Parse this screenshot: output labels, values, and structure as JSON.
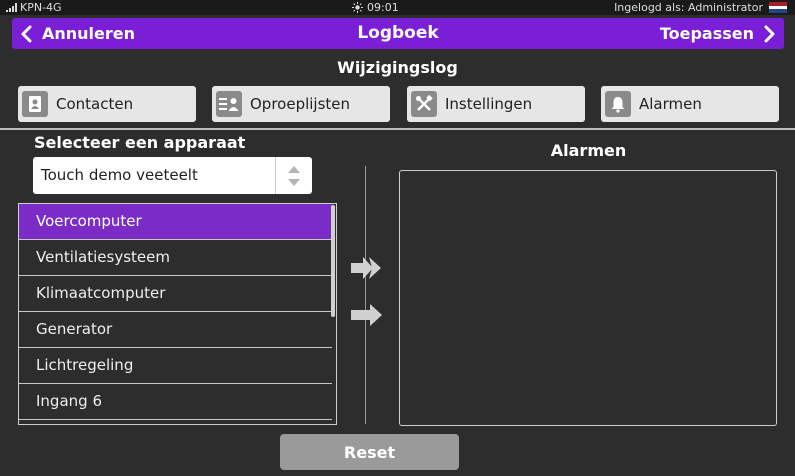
{
  "status": {
    "carrier": "KPN-4G",
    "time": "09:01",
    "login": "Ingelogd als: Administrator"
  },
  "header": {
    "cancel_label": "Annuleren",
    "title": "Logboek",
    "apply_label": "Toepassen"
  },
  "subtitle": "Wijzigingslog",
  "tabs": [
    {
      "label": "Contacten",
      "icon": "contact-icon"
    },
    {
      "label": "Oproeplijsten",
      "icon": "call-list-icon"
    },
    {
      "label": "Instellingen",
      "icon": "tools-icon"
    },
    {
      "label": "Alarmen",
      "icon": "bell-icon"
    }
  ],
  "device": {
    "label": "Selecteer een apparaat",
    "selected": "Touch demo veeteelt"
  },
  "list": {
    "items": [
      "Voercomputer",
      "Ventilatiesysteem",
      "Klimaatcomputer",
      "Generator",
      "Lichtregeling",
      "Ingang 6"
    ],
    "selected_index": 0
  },
  "alarms": {
    "title": "Alarmen"
  },
  "reset_label": "Reset",
  "colors": {
    "accent": "#7b1fd6",
    "selected_row": "#7b2bc6",
    "background": "#2d2d2d"
  }
}
